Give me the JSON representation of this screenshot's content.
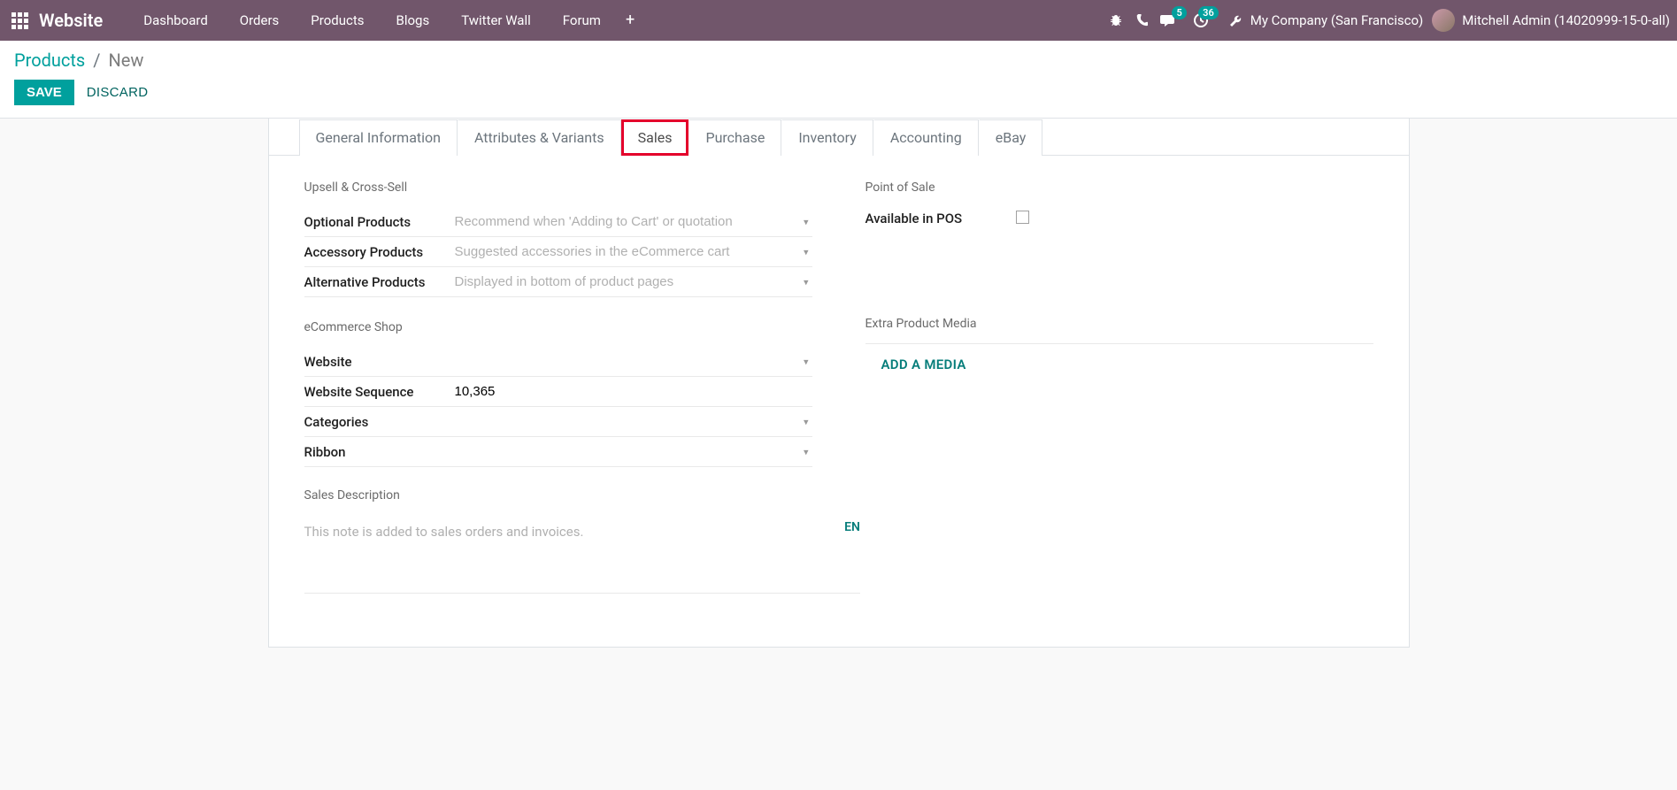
{
  "topnav": {
    "brand": "Website",
    "links": [
      "Dashboard",
      "Orders",
      "Products",
      "Blogs",
      "Twitter Wall",
      "Forum"
    ],
    "badge_messages": "5",
    "badge_activities": "36",
    "company": "My Company (San Francisco)",
    "user": "Mitchell Admin (14020999-15-0-all)"
  },
  "breadcrumb": {
    "root": "Products",
    "current": "New"
  },
  "actions": {
    "save": "SAVE",
    "discard": "DISCARD"
  },
  "tabs": [
    "General Information",
    "Attributes & Variants",
    "Sales",
    "Purchase",
    "Inventory",
    "Accounting",
    "eBay"
  ],
  "active_tab_index": 2,
  "sections": {
    "upsell": {
      "title": "Upsell & Cross-Sell",
      "optional_label": "Optional Products",
      "optional_placeholder": "Recommend when 'Adding to Cart' or quotation",
      "accessory_label": "Accessory Products",
      "accessory_placeholder": "Suggested accessories in the eCommerce cart",
      "alternative_label": "Alternative Products",
      "alternative_placeholder": "Displayed in bottom of product pages"
    },
    "pos": {
      "title": "Point of Sale",
      "available_label": "Available in POS"
    },
    "ecom": {
      "title": "eCommerce Shop",
      "website_label": "Website",
      "seq_label": "Website Sequence",
      "seq_value": "10,365",
      "categories_label": "Categories",
      "ribbon_label": "Ribbon"
    },
    "media": {
      "title": "Extra Product Media",
      "add": "ADD A MEDIA"
    },
    "desc": {
      "title": "Sales Description",
      "placeholder": "This note is added to sales orders and invoices.",
      "lang": "EN"
    }
  }
}
